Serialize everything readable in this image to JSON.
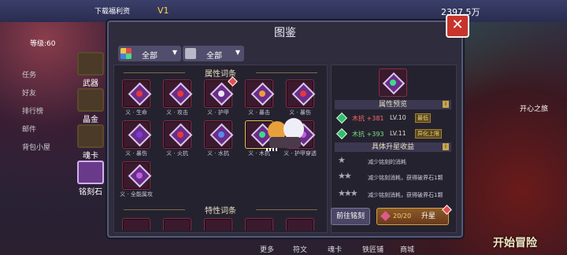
{
  "background": {
    "top_texts": [
      "下载福利资",
      "V1",
      "2397.5万"
    ],
    "left_top_label": "等级:60",
    "left_items": [
      "任务",
      "好友",
      "排行榜",
      "邮件",
      "背包小屋"
    ],
    "side_tabs": [
      "武器",
      "晶金",
      "魂卡",
      "铭刻石"
    ],
    "right_label": "开心之旅",
    "bottom_nav": [
      "更多",
      "符文",
      "魂卡",
      "铁匠铺",
      "商城"
    ],
    "start_button": "开始冒险"
  },
  "dialog": {
    "title": "图鉴",
    "close": "✕",
    "filters": [
      {
        "label": "全部",
        "arrow": "▼",
        "icon": "grid-color-icon",
        "color": "#4a7ed8"
      },
      {
        "label": "全部",
        "arrow": "▼",
        "icon": "wardrobe-icon",
        "color": "#b8b8c8"
      }
    ],
    "attr_section": "属性词条",
    "trait_section": "特性词条",
    "attr_items": [
      {
        "label": "义 · 生命",
        "core": "#e23a3a"
      },
      {
        "label": "义 · 攻击",
        "core": "#e23a3a"
      },
      {
        "label": "义 · 护甲",
        "core": "#e8e8f0",
        "badge": true
      },
      {
        "label": "义 · 暴击",
        "core": "#e8a03a"
      },
      {
        "label": "义 · 暴伤",
        "core": "#e23a3a"
      },
      {
        "label": "义 · 暴伤",
        "core": "#7a3ad8"
      },
      {
        "label": "义 · 火抗",
        "core": "#e23a3a"
      },
      {
        "label": "义 · 水抗",
        "core": "#5a8ae8"
      },
      {
        "label": "义 · 木抗",
        "core": "#3fd88a"
      },
      {
        "label": "义 · 护甲穿透",
        "core": "#c060e0"
      },
      {
        "label": "义 · 全能属攻",
        "core": "#c060e0"
      }
    ],
    "preview": {
      "header": "属性预览",
      "rows": [
        {
          "name": "木抗 +381",
          "lv": "LV.10",
          "tag": "最低",
          "color": "#ff6a6a"
        },
        {
          "name": "木抗 +393",
          "lv": "LV.11",
          "tag": "异化上限",
          "color": "#7be08a"
        }
      ],
      "income_header": "具体升星收益",
      "income_rows": [
        {
          "stars": "★",
          "text": "减少铭刻的消耗"
        },
        {
          "stars": "★★",
          "text": "减少铭刻消耗，获得破界石1颗"
        },
        {
          "stars": "★★★",
          "text": "减少铭刻消耗，获得破界石1颗"
        }
      ]
    },
    "buttons": {
      "go": "前往铭刻",
      "count": "20/20",
      "upgrade": "升星"
    }
  }
}
